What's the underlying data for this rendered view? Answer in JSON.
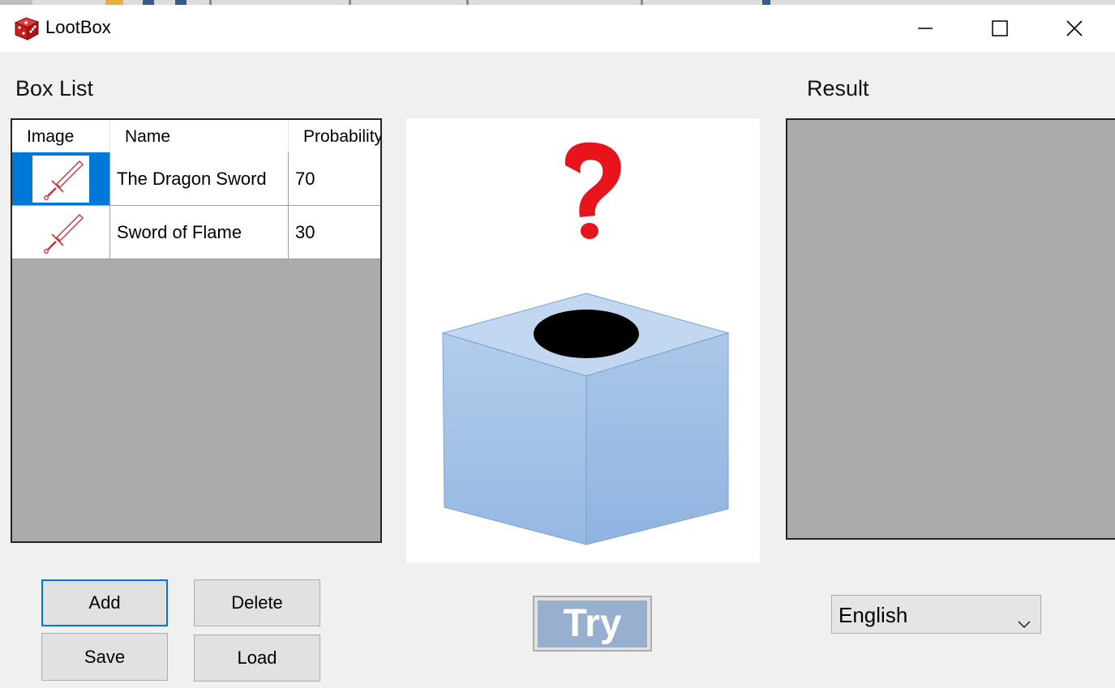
{
  "window": {
    "title": "LootBox"
  },
  "sections": {
    "box_list": "Box List",
    "result": "Result"
  },
  "table": {
    "columns": [
      "Image",
      "Name",
      "Probability"
    ],
    "rows": [
      {
        "name": "The Dragon Sword",
        "probability": "70",
        "icon": "sword-icon",
        "selected": true
      },
      {
        "name": "Sword of Flame",
        "probability": "30",
        "icon": "sword-icon",
        "selected": false
      }
    ]
  },
  "buttons": {
    "add": "Add",
    "delete": "Delete",
    "save": "Save",
    "load": "Load",
    "try": "Try"
  },
  "language": {
    "selected": "English"
  },
  "colors": {
    "accent": "#0078d7",
    "try_fill": "#98b0d0",
    "question_mark": "#e8141c",
    "box_blue": "#9bbde6",
    "panel_gray": "#ababab"
  }
}
